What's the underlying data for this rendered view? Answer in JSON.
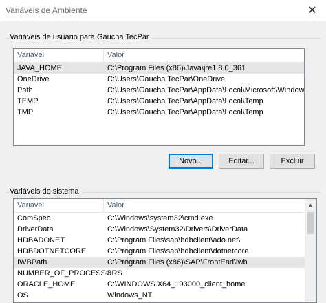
{
  "window": {
    "title": "Variáveis de Ambiente"
  },
  "user_vars": {
    "label": "Variáveis de usuário para Gaucha TecPar",
    "columns": [
      "Variável",
      "Valor"
    ],
    "rows": [
      {
        "name": "JAVA_HOME",
        "value": "C:\\Program Files (x86)\\Java\\jre1.8.0_361"
      },
      {
        "name": "OneDrive",
        "value": "C:\\Users\\Gaucha TecPar\\OneDrive"
      },
      {
        "name": "Path",
        "value": "C:\\Users\\Gaucha TecPar\\AppData\\Local\\Microsoft\\WindowsA..."
      },
      {
        "name": "TEMP",
        "value": "C:\\Users\\Gaucha TecPar\\AppData\\Local\\Temp"
      },
      {
        "name": "TMP",
        "value": "C:\\Users\\Gaucha TecPar\\AppData\\Local\\Temp"
      }
    ],
    "buttons": {
      "new": "Novo...",
      "edit": "Editar...",
      "delete": "Excluir"
    }
  },
  "system_vars": {
    "label": "Variáveis do sistema",
    "columns": [
      "Variável",
      "Valor"
    ],
    "rows": [
      {
        "name": "ComSpec",
        "value": "C:\\Windows\\system32\\cmd.exe"
      },
      {
        "name": "DriverData",
        "value": "C:\\Windows\\System32\\Drivers\\DriverData"
      },
      {
        "name": "HDBADONET",
        "value": "C:\\Program Files\\sap\\hdbclient\\ado.net\\"
      },
      {
        "name": "HDBDOTNETCORE",
        "value": "C:\\Program Files\\sap\\hdbclient\\dotnetcore"
      },
      {
        "name": "IWBPath",
        "value": "C:\\Program Files (x86)\\SAP\\FrontEnd\\iwb"
      },
      {
        "name": "NUMBER_OF_PROCESSORS",
        "value": "8"
      },
      {
        "name": "ORACLE_HOME",
        "value": "C:\\WINDOWS.X64_193000_client_home"
      },
      {
        "name": "OS",
        "value": "Windows_NT"
      }
    ]
  },
  "colors": {
    "accent": "#0078d7",
    "selected_row": "#e5e5e5"
  }
}
